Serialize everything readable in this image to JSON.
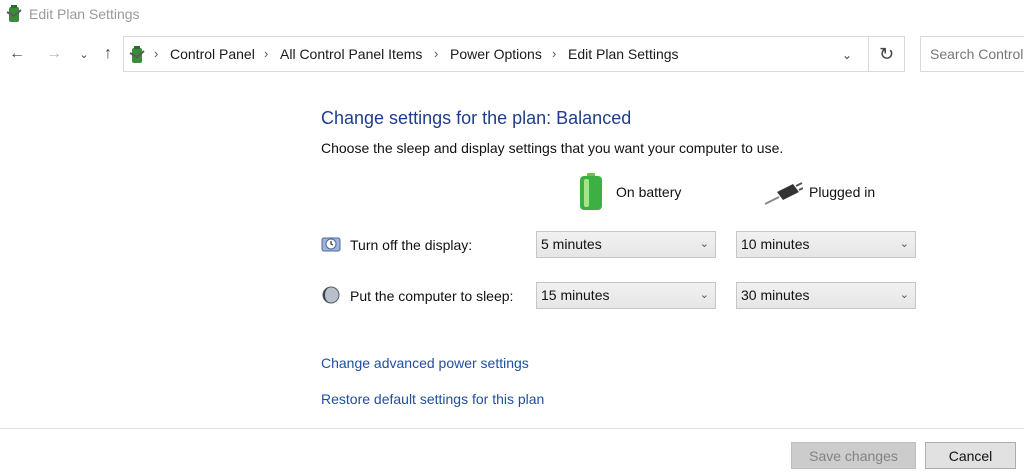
{
  "window": {
    "title": "Edit Plan Settings",
    "icon": "power-options-icon"
  },
  "nav": {
    "back_icon": "arrow-left-icon",
    "forward_icon": "arrow-right-icon",
    "recent_icon": "chevron-down-icon",
    "up_icon": "arrow-up-icon",
    "breadcrumbs": [
      "Control Panel",
      "All Control Panel Items",
      "Power Options",
      "Edit Plan Settings"
    ],
    "refresh_icon": "refresh-icon",
    "search_placeholder": "Search Control Panel"
  },
  "main": {
    "heading": "Change settings for the plan: Balanced",
    "description": "Choose the sleep and display settings that you want your computer to use.",
    "columns": {
      "battery": "On battery",
      "plugged": "Plugged in"
    },
    "rows": [
      {
        "label": "Turn off the display:",
        "icon": "display-clock-icon",
        "battery": "5 minutes",
        "plugged": "10 minutes"
      },
      {
        "label": "Put the computer to sleep:",
        "icon": "sleep-moon-icon",
        "battery": "15 minutes",
        "plugged": "30 minutes"
      }
    ],
    "links": {
      "advanced": "Change advanced power settings",
      "restore": "Restore default settings for this plan"
    }
  },
  "footer": {
    "save_label": "Save changes",
    "cancel_label": "Cancel"
  },
  "colors": {
    "heading": "#1e3d8f",
    "link": "#1f4fa0",
    "battery_green": "#3cb043"
  }
}
